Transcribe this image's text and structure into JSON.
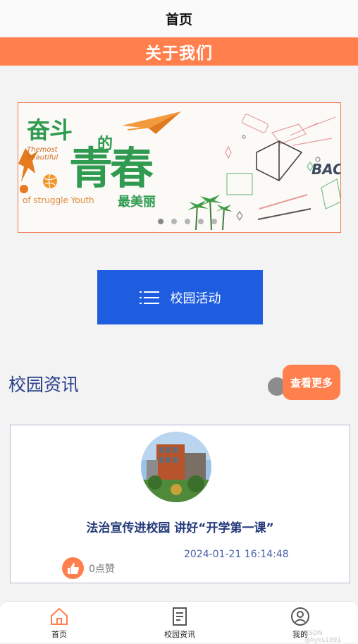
{
  "header": {
    "title": "首页"
  },
  "about": {
    "label": "关于我们"
  },
  "banner": {
    "line1": "奋斗",
    "de": "的",
    "line2": "青春",
    "line3": "最美丽",
    "en_small": "Themost beautiful",
    "en_big": "of struggle Youth",
    "bac": "BAC",
    "dots": 5,
    "active_dot": 0
  },
  "campus_activity": {
    "label": "校园活动"
  },
  "news": {
    "heading": "校园资讯",
    "more_label": "查看更多",
    "items": [
      {
        "title": "法治宣传进校园 讲好“开学第一课”",
        "date": "2024-01-21 16:14:48",
        "likes": "0点赞"
      }
    ]
  },
  "tabbar": {
    "items": [
      {
        "label": "首页",
        "icon": "home-icon",
        "active": true
      },
      {
        "label": "校园资讯",
        "icon": "document-icon"
      },
      {
        "label": "我的",
        "icon": "user-icon"
      }
    ]
  },
  "watermark": "CSDN @kyks1991",
  "colors": {
    "accent": "#ff7f4d",
    "primary_blue": "#1f5de0",
    "heading_blue": "#29408a",
    "green": "#2f9a50"
  }
}
